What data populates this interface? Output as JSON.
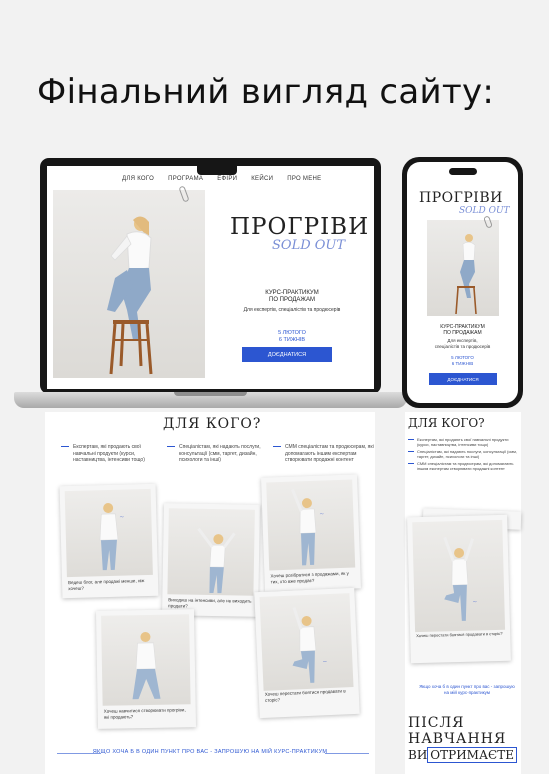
{
  "page_title": "Фінальний вигляд сайту:",
  "desktop": {
    "nav": [
      "ДЛЯ КОГО",
      "ПРОГРАМА",
      "ЕФІРИ",
      "КЕЙСИ",
      "ПРО МЕНЕ"
    ],
    "title": "ПРОГРІВИ",
    "script": "SOLD OUT",
    "subtitle": "КУРС-ПРАКТИКУМ\nПО ПРОДАЖАМ",
    "description": "Для експертів, спеціалістів та продюсерів",
    "date": "5 ЛЮТОГО\n6 ТИЖНІВ",
    "button": "ДОЄДНАТИСЯ"
  },
  "mobile": {
    "title": "ПРОГРІВИ",
    "script": "SOLD OUT",
    "subtitle": "КУРС-ПРАКТИКУМ\nПО ПРОДАЖАМ",
    "description": "Для експертів,\nспеціалістів та продюсерів",
    "date": "5 ЛЮТОГО\n6 ТИЖНІВ",
    "button": "ДОЄДНАТИСЯ"
  },
  "for_whom": {
    "heading": "ДЛЯ КОГО?",
    "columns": [
      "Експертам, які продають свої навчальні продукти (курси, наставництва, інтенсиви тощо)",
      "Спеціалістам, які надають послуги, консультації (смм, таргет, дизайн, психологи та інші)",
      "СММ спеціалістам та продюсерам, які допомагають іншим експертам створювати продажні контент"
    ],
    "captions": [
      "Ведеш блог, але продажі менше, ніж хочеш?",
      "Виходиш на інтенсиви, але не виходить продати?",
      "Хочеш розібратися з продажами, як у тих, хто вже продає?",
      "Хочеш навчитися створювати прогріви, які продають?",
      "Хочеш перестати боятися продавати в сторіс?"
    ],
    "cta": "ЯКЩО ХОЧА Б В ОДИН ПУНКТ ПРО ВАС - ЗАПРОШУЮ НА МІЙ КУРС-ПРАКТИКУМ"
  },
  "mobile_section": {
    "heading": "ДЛЯ КОГО?",
    "items": [
      "Експертам, які продають свої навчальні продукти (курси, наставництва, інтенсиви тощо)",
      "Спеціалістам, які надають послуги, консультації (смм, таргет, дизайн, психологи та інші)",
      "СММ спеціалістам та продюсерам, які допомагають іншим експертам створювати продажні контент"
    ],
    "cta": "Якщо хоча б в один пункт про вас - запрошую на мій курс-практикум",
    "after": "ПІСЛЯ\nНАВЧАННЯ",
    "get_prefix": "ВИ",
    "get_word": "ОТРИМАЄТЕ"
  },
  "colors": {
    "accent": "#2c56d1",
    "script": "#7a8fd6"
  }
}
